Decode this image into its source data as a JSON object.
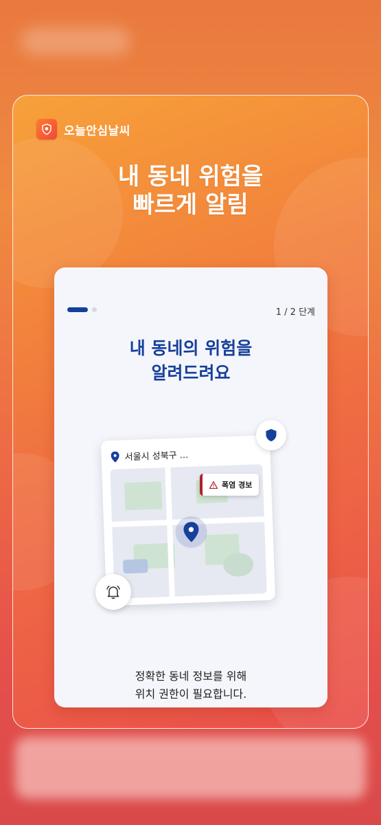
{
  "app": {
    "name": "오늘안심날씨",
    "logo_icon": "shield-sun-icon"
  },
  "headline": {
    "line1": "내 동네 위험을",
    "line2": "빠르게 알림"
  },
  "onboarding": {
    "step_label": "1 / 2 단계",
    "progress": {
      "current": 1,
      "total": 2
    },
    "title_line1": "내 동네의 위험을",
    "title_line2": "알려드려요",
    "description_line1": "정확한 동네 정보를 위해",
    "description_line2": "위치 권한이 필요합니다."
  },
  "illustration": {
    "address": "서울시 성북구 ...",
    "alert_label": "폭염 경보",
    "icons": [
      "location-pin-icon",
      "warning-triangle-icon",
      "shield-icon",
      "bell-icon"
    ]
  },
  "colors": {
    "accent": "#16409a",
    "alert": "#b3202b",
    "background_top": "#f7a13a",
    "background_bottom": "#e6504b"
  }
}
